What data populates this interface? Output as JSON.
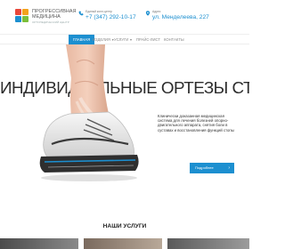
{
  "brand": {
    "name_line1": "ПРОГРЕССИВНАЯ",
    "name_line2": "МЕДИЦИНА",
    "tagline": "ОРТОПЕДИЧЕСКИЙ ЦЕНТР",
    "colors": [
      "#e8473a",
      "#f3a21b",
      "#1c8fd0",
      "#7bbf3a"
    ]
  },
  "contacts": {
    "phone_label": "Единый колл-центр",
    "phone": "+7 (347) 292-10-17",
    "phone_icon": "phone-icon",
    "address_label": "Адрес",
    "address": "ул. Менделеева, 227",
    "address_icon": "map-pin-icon"
  },
  "nav": {
    "items": [
      {
        "label": "ГЛАВНАЯ",
        "active": true
      },
      {
        "label": "ИЗДЕЛИЯ",
        "has_dropdown": true
      },
      {
        "label": "УСЛУГИ",
        "has_dropdown": true
      },
      {
        "label": "ПРАЙС-ЛИСТ"
      },
      {
        "label": "КОНТАКТЫ"
      }
    ],
    "accent": "#1c8fd0"
  },
  "hero": {
    "title": "ИНДИВИДУАЛЬНЫЕ ОРТЕЗЫ СТОПЫ",
    "description": "Клинически доказанная медицинская система для лечения болезней опорно-двигательного аппарата, снятия боли в суставах и восстановления функций стопы",
    "button_label": "Подробнее",
    "button_icon": "arrow-right-icon"
  },
  "services": {
    "title": "НАШИ УСЛУГИ"
  }
}
